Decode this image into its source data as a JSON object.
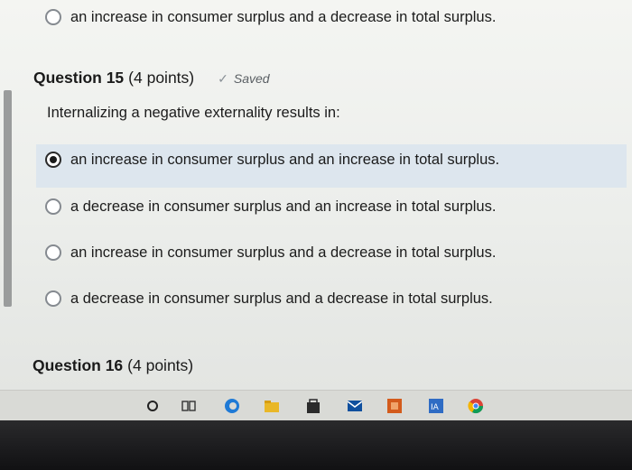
{
  "top_option": "an increase in consumer surplus and a decrease in total surplus.",
  "q15": {
    "title": "Question 15",
    "points": "(4 points)",
    "saved": "Saved",
    "prompt": "Internalizing a negative externality results in:",
    "options": [
      "an increase in consumer surplus and an increase in total surplus.",
      "a decrease in consumer surplus and an increase in total surplus.",
      "an increase in consumer surplus and a decrease in total surplus.",
      "a decrease in consumer surplus and a decrease in total surplus."
    ],
    "selected_index": 0
  },
  "q16": {
    "title": "Question 16",
    "points": "(4 points)"
  },
  "taskbar_icons": [
    "search-icon",
    "task-view-icon",
    "edge-browser-icon",
    "file-explorer-icon",
    "store-icon",
    "mail-icon",
    "office-icon",
    "teams-icon",
    "chrome-icon"
  ],
  "colors": {
    "selected_row": "#dde6ee",
    "page_bg": "#f0f1ee",
    "taskbar": "#d9dad6"
  }
}
